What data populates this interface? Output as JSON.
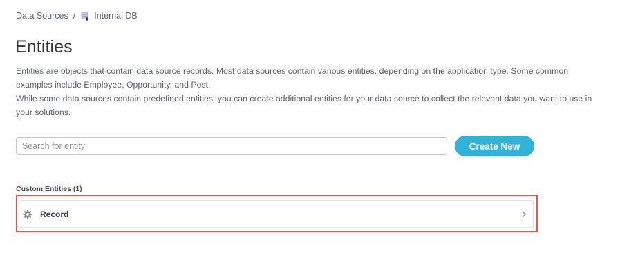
{
  "breadcrumb": {
    "root": "Data Sources",
    "separator": "/",
    "current": "Internal DB",
    "current_icon": "database-icon"
  },
  "page": {
    "title": "Entities",
    "description_1": "Entities are objects that contain data source records. Most data sources contain various entities, depending on the application type. Some common examples include Employee, Opportunity, and Post.",
    "description_2": "While some data sources contain predefined entities, you can create additional entities for your data source to collect the relevant data you want to use in your solutions."
  },
  "search": {
    "placeholder": "Search for entity",
    "value": ""
  },
  "actions": {
    "create_label": "Create New"
  },
  "custom_entities": {
    "label": "Custom Entities (1)",
    "items": [
      {
        "name": "Record",
        "icon": "gear-icon"
      }
    ]
  },
  "colors": {
    "accent": "#33b2d9",
    "highlight": "#e8564a",
    "text": "#3c4046"
  }
}
